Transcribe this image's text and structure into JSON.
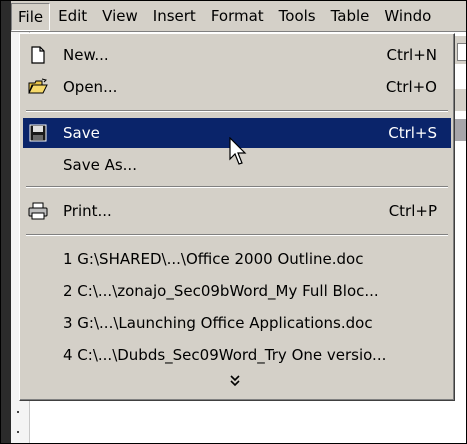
{
  "menubar": {
    "items": [
      {
        "label": "File"
      },
      {
        "label": "Edit"
      },
      {
        "label": "View"
      },
      {
        "label": "Insert"
      },
      {
        "label": "Format"
      },
      {
        "label": "Tools"
      },
      {
        "label": "Table"
      },
      {
        "label": "Windo"
      }
    ]
  },
  "file_menu": {
    "new": {
      "label": "New...",
      "shortcut": "Ctrl+N",
      "icon": "new-document-icon"
    },
    "open": {
      "label": "Open...",
      "shortcut": "Ctrl+O",
      "icon": "open-folder-icon"
    },
    "save": {
      "label": "Save",
      "shortcut": "Ctrl+S",
      "icon": "floppy-disk-icon"
    },
    "saveas": {
      "label": "Save As..."
    },
    "print": {
      "label": "Print...",
      "shortcut": "Ctrl+P",
      "icon": "printer-icon"
    },
    "recent": [
      {
        "label": "1 G:\\SHARED\\...\\Office 2000 Outline.doc"
      },
      {
        "label": "2 C:\\...\\zonajo_Sec09bWord_My Full Bloc..."
      },
      {
        "label": "3 G:\\...\\Launching Office Applications.doc"
      },
      {
        "label": "4 C:\\...\\Dubds_Sec09Word_Try One versio..."
      }
    ],
    "expand_icon": "double-chevron-down-icon"
  },
  "colors": {
    "menu_bg": "#d4d0c8",
    "highlight": "#0a246a",
    "highlight_text": "#ffffff"
  }
}
